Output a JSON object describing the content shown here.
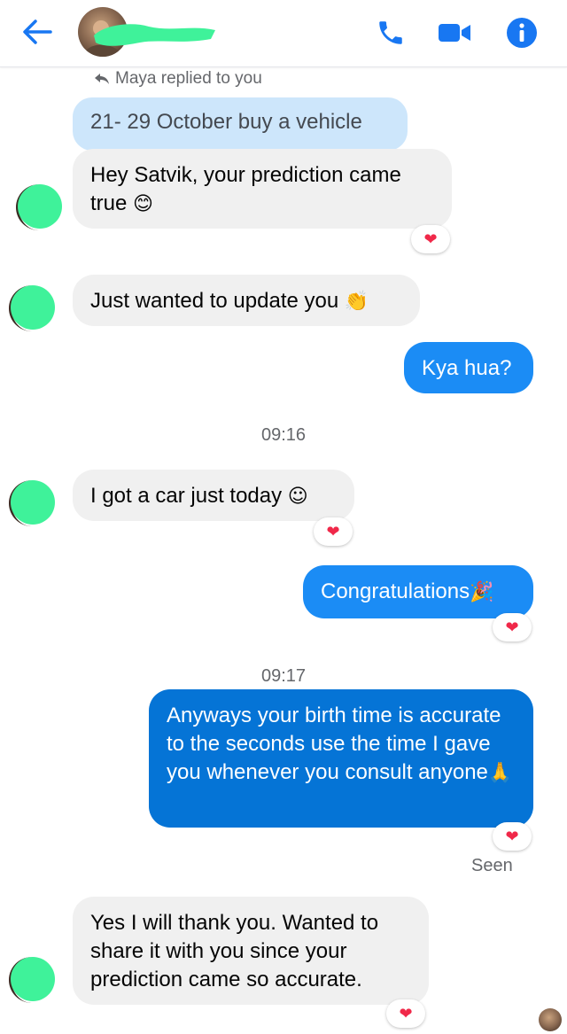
{
  "header": {
    "contact_name": "",
    "icons": [
      "back-arrow-icon",
      "phone-icon",
      "video-camera-icon",
      "info-icon"
    ],
    "accent_color": "#1877f2"
  },
  "reply": {
    "note": "Maya replied to you",
    "quote": "21- 29 October buy a vehicle"
  },
  "messages": [
    {
      "text": "Hey Satvik, your prediction came true",
      "emoji": "😊",
      "reaction": "❤"
    },
    {
      "text": "Just wanted to update you",
      "emoji": "👏"
    },
    {
      "text": "Kya hua?"
    },
    {
      "time": "09:16"
    },
    {
      "text": "I got a car just today",
      "emoji": "☺",
      "reaction": "❤"
    },
    {
      "text": "Congratulations",
      "emoji": "🎉",
      "reaction": "❤"
    },
    {
      "time": "09:17"
    },
    {
      "text": "Anyways your birth time is accurate to the seconds use the time I gave you whenever you consult anyone",
      "emoji": "🙏",
      "reaction": "❤"
    },
    {
      "status": "Seen"
    },
    {
      "text": "Yes I will thank you. Wanted to share it with you since your prediction came so accurate.",
      "reaction": "❤"
    }
  ],
  "colors": {
    "incoming_bubble": "#f0f0f0",
    "outgoing_bubble": "#1b8cf5",
    "reaction_heart": "#f02849",
    "redaction_green": "#3ff29a"
  }
}
